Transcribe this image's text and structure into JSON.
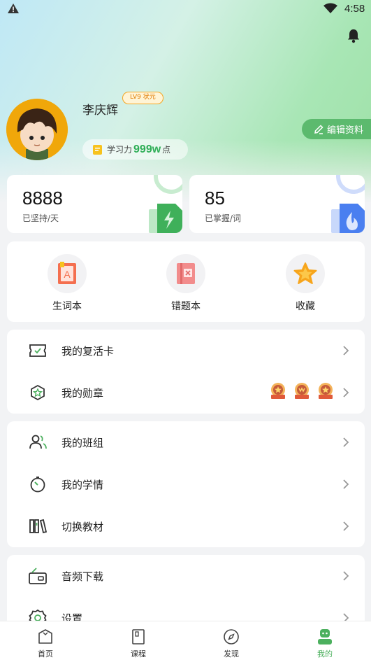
{
  "status_bar": {
    "time": "4:58"
  },
  "profile": {
    "name": "李庆辉",
    "level_badge": "LV9 状元",
    "power_label": "学习力",
    "power_value": "999w",
    "power_unit": "点",
    "edit_label": "编辑资料"
  },
  "stats": [
    {
      "value": "8888",
      "label": "已坚持/天"
    },
    {
      "value": "85",
      "label": "已掌握/词"
    }
  ],
  "quick_actions": [
    {
      "label": "生词本",
      "icon": "vocabulary-book-icon"
    },
    {
      "label": "错题本",
      "icon": "wrong-questions-book-icon"
    },
    {
      "label": "收藏",
      "icon": "star-icon"
    }
  ],
  "menu_group1": [
    {
      "label": "我的复活卡",
      "icon": "ticket-icon"
    },
    {
      "label": "我的勋章",
      "icon": "medal-icon"
    }
  ],
  "menu_group2": [
    {
      "label": "我的班组",
      "icon": "users-icon"
    },
    {
      "label": "我的学情",
      "icon": "gauge-icon"
    },
    {
      "label": "切换教材",
      "icon": "books-icon"
    }
  ],
  "menu_group3": [
    {
      "label": "音频下载",
      "icon": "radio-icon"
    },
    {
      "label": "设置",
      "icon": "gear-icon"
    }
  ],
  "tabs": [
    {
      "label": "首页",
      "icon": "home-icon"
    },
    {
      "label": "课程",
      "icon": "course-icon"
    },
    {
      "label": "发现",
      "icon": "compass-icon"
    },
    {
      "label": "我的",
      "icon": "profile-icon",
      "active": true
    }
  ],
  "colors": {
    "accent": "#4cb05e",
    "badge": "#f5a623"
  }
}
